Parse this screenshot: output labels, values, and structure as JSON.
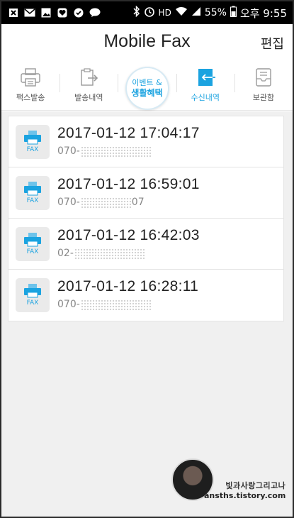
{
  "status_bar": {
    "left_icons": [
      "close-box-icon",
      "envelope-icon",
      "image-icon",
      "heart-icon",
      "check-icon",
      "talk-icon"
    ],
    "bluetooth": "bluetooth-icon",
    "alarm": "alarm-icon",
    "hd": "HD",
    "battery": "55%",
    "time": "오후 9:55"
  },
  "header": {
    "title": "Mobile Fax",
    "edit_label": "편집"
  },
  "tabs": [
    {
      "label": "팩스발송",
      "icon": "printer-icon"
    },
    {
      "label": "발송내역",
      "icon": "outbox-icon"
    },
    {
      "label_line1": "이벤트 &",
      "label_line2": "생활혜택"
    },
    {
      "label": "수신내역",
      "icon": "inbox-icon"
    },
    {
      "label": "보관함",
      "icon": "storage-icon"
    }
  ],
  "faxes": [
    {
      "badge": "FAX",
      "time": "2017-01-12 17:04:17",
      "number_prefix": "070-"
    },
    {
      "badge": "FAX",
      "time": "2017-01-12 16:59:01",
      "number_prefix": "070-",
      "number_suffix": "07"
    },
    {
      "badge": "FAX",
      "time": "2017-01-12 16:42:03",
      "number_prefix": "02-"
    },
    {
      "badge": "FAX",
      "time": "2017-01-12 16:28:11",
      "number_prefix": "070-"
    }
  ],
  "watermark": {
    "line1": "빛과사랑그리고나",
    "line2": "ansths.tistory.com"
  },
  "colors": {
    "accent": "#1ba3e0",
    "background": "#f0f0f0"
  }
}
